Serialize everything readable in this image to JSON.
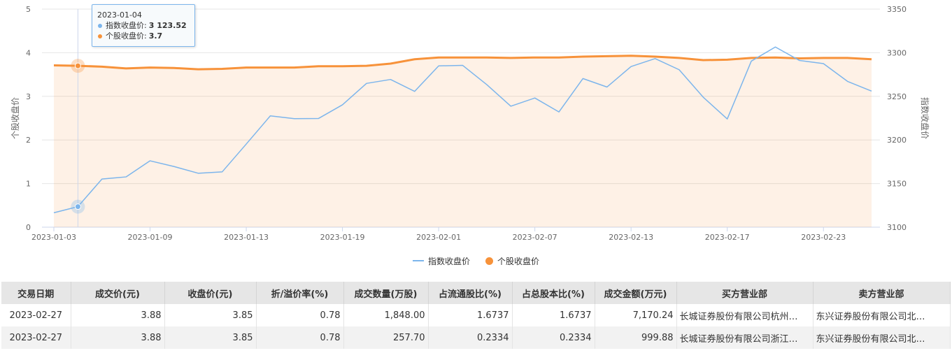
{
  "chart_data": {
    "type": "line",
    "x": [
      "2023-01-03",
      "2023-01-04",
      "2023-01-05",
      "2023-01-06",
      "2023-01-09",
      "2023-01-10",
      "2023-01-11",
      "2023-01-12",
      "2023-01-13",
      "2023-01-16",
      "2023-01-17",
      "2023-01-18",
      "2023-01-19",
      "2023-01-20",
      "2023-01-30",
      "2023-01-31",
      "2023-02-01",
      "2023-02-02",
      "2023-02-03",
      "2023-02-06",
      "2023-02-07",
      "2023-02-08",
      "2023-02-09",
      "2023-02-10",
      "2023-02-13",
      "2023-02-14",
      "2023-02-15",
      "2023-02-16",
      "2023-02-17",
      "2023-02-20",
      "2023-02-21",
      "2023-02-22",
      "2023-02-23",
      "2023-02-24",
      "2023-02-27"
    ],
    "x_ticks": [
      "2023-01-03",
      "2023-01-09",
      "2023-01-13",
      "2023-01-19",
      "2023-02-01",
      "2023-02-07",
      "2023-02-13",
      "2023-02-17",
      "2023-02-23"
    ],
    "series": [
      {
        "name": "指数收盘价",
        "axis": "right",
        "color": "#7cb5ec",
        "values": [
          3116.51,
          3123.52,
          3155.22,
          3157.64,
          3176.08,
          3169.51,
          3161.84,
          3163.45,
          3195.31,
          3227.59,
          3224.41,
          3224.57,
          3240.28,
          3264.81,
          3269.32,
          3255.67,
          3284.92,
          3285.46,
          3263.41,
          3238.7,
          3248.09,
          3232.11,
          3270.38,
          3260.67,
          3284.16,
          3293.28,
          3280.49,
          3249.03,
          3224.02,
          3290.34,
          3306.52,
          3291.15,
          3287.48,
          3267.16,
          3255.96
        ]
      },
      {
        "name": "个股收盘价",
        "axis": "left",
        "color": "#f7923a",
        "values": [
          3.71,
          3.7,
          3.68,
          3.64,
          3.66,
          3.65,
          3.62,
          3.63,
          3.66,
          3.66,
          3.66,
          3.69,
          3.69,
          3.7,
          3.75,
          3.85,
          3.89,
          3.89,
          3.89,
          3.88,
          3.89,
          3.89,
          3.91,
          3.92,
          3.93,
          3.91,
          3.88,
          3.83,
          3.84,
          3.88,
          3.89,
          3.87,
          3.88,
          3.88,
          3.85
        ]
      }
    ],
    "y_left": {
      "label": "个股收盘价",
      "ylim": [
        0,
        5
      ],
      "ticks": [
        "0",
        "1",
        "2",
        "3",
        "4",
        "5"
      ]
    },
    "y_right": {
      "label": "指数收盘价",
      "ylim": [
        3100,
        3350
      ],
      "ticks": [
        "3100",
        "3150",
        "3200",
        "3250",
        "3300",
        "3350"
      ]
    },
    "grid": true,
    "legend": "bottom-center",
    "hover_index": 1
  },
  "tooltip": {
    "date": "2023-01-04",
    "index_label": "指数收盘价:",
    "index_value": "3 123.52",
    "stock_label": "个股收盘价:",
    "stock_value": "3.7"
  },
  "legend": {
    "index": "指数收盘价",
    "stock": "个股收盘价"
  },
  "table": {
    "headers": [
      "交易日期",
      "成交价(元)",
      "收盘价(元)",
      "折/溢价率(%)",
      "成交数量(万股)",
      "占流通股比(%)",
      "占总股本比(%)",
      "成交金额(万元)",
      "买方营业部",
      "卖方营业部"
    ],
    "rows": [
      [
        "2023-02-27",
        "3.88",
        "3.85",
        "0.78",
        "1,848.00",
        "1.6737",
        "1.6737",
        "7,170.24",
        "长城证券股份有限公司杭州…",
        "东兴证券股份有限公司北…"
      ],
      [
        "2023-02-27",
        "3.88",
        "3.85",
        "0.78",
        "257.70",
        "0.2334",
        "0.2334",
        "999.88",
        "长城证券股份有限公司浙江…",
        "东兴证券股份有限公司北…"
      ]
    ]
  }
}
